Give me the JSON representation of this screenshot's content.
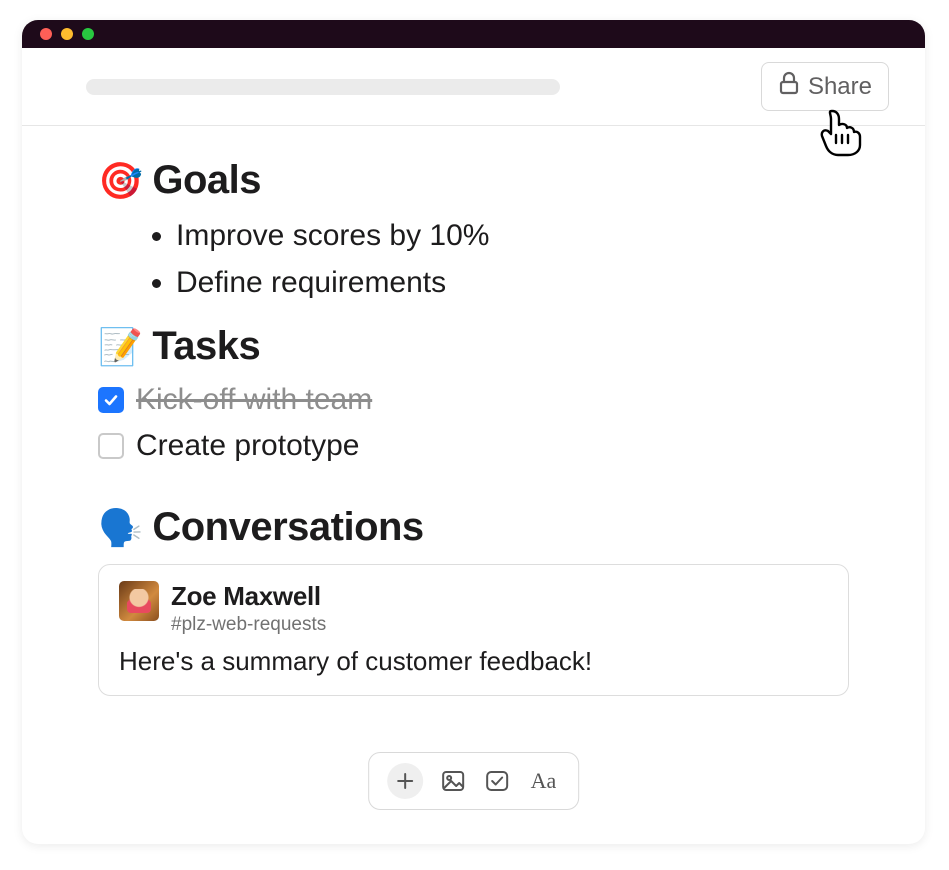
{
  "toolbar": {
    "share_label": "Share"
  },
  "sections": {
    "goals": {
      "emoji": "🎯",
      "title": "Goals",
      "items": [
        "Improve scores by 10%",
        "Define requirements"
      ]
    },
    "tasks": {
      "emoji": "📝",
      "title": "Tasks",
      "items": [
        {
          "label": "Kick-off with team",
          "done": true
        },
        {
          "label": "Create prototype",
          "done": false
        }
      ]
    },
    "conversations": {
      "emoji": "🗣️",
      "title": "Conversations",
      "message": {
        "author": "Zoe Maxwell",
        "channel": "#plz-web-requests",
        "body": "Here's a summary of customer feedback!"
      }
    }
  }
}
